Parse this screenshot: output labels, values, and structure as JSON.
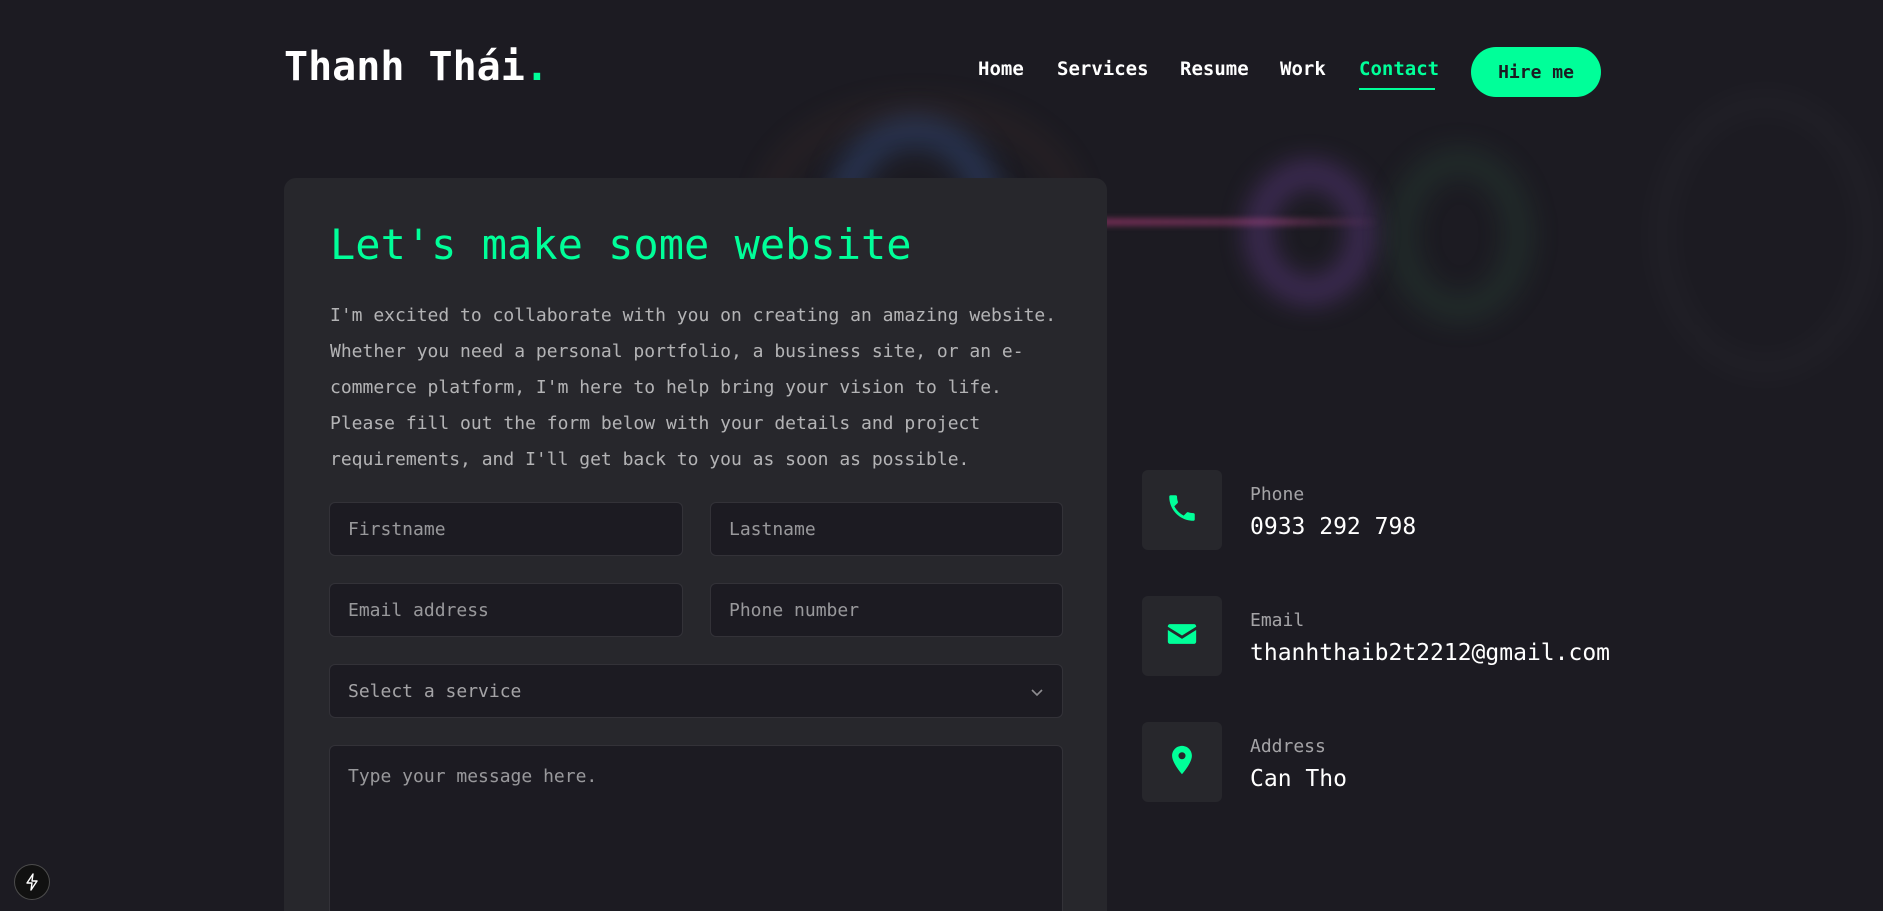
{
  "header": {
    "logo_text": "Thanh Thái",
    "logo_dot": ".",
    "nav": {
      "home": "Home",
      "services": "Services",
      "resume": "Resume",
      "work": "Work",
      "contact": "Contact"
    },
    "active_nav": "Contact",
    "hire_button": "Hire me"
  },
  "form": {
    "title": "Let's make some website",
    "description": "I'm excited to collaborate with you on creating an amazing website. Whether you need a personal portfolio, a business site, or an e-commerce platform, I'm here to help bring your vision to life. Please fill out the form below with your details and project requirements, and I'll get back to you as soon as possible.",
    "firstname_placeholder": "Firstname",
    "lastname_placeholder": "Lastname",
    "email_placeholder": "Email address",
    "phone_placeholder": "Phone number",
    "service_select": "Select a service",
    "message_placeholder": "Type your message here."
  },
  "contact_info": {
    "phone": {
      "label": "Phone",
      "value": "0933 292 798",
      "icon": "phone-icon"
    },
    "email": {
      "label": "Email",
      "value": "thanhthaib2t2212@gmail.com",
      "icon": "envelope-icon"
    },
    "address": {
      "label": "Address",
      "value": "Can Tho",
      "icon": "map-pin-icon"
    }
  },
  "colors": {
    "background": "#1c1b22",
    "card": "#27272c",
    "accent": "#00ff99"
  },
  "dev_indicator_icon": "lightning-bolt-icon"
}
